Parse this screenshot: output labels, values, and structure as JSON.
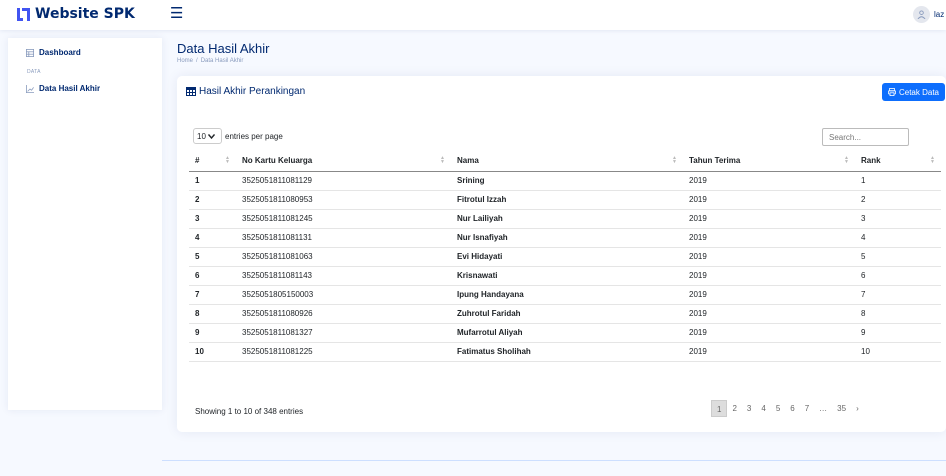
{
  "header": {
    "brand": "Website SPK",
    "user_name": "laz"
  },
  "sidebar": {
    "dashboard_label": "Dashboard",
    "section_heading": "DATA",
    "data_label": "Data Hasil Akhir"
  },
  "page": {
    "title": "Data Hasil Akhir",
    "breadcrumb_home": "Home",
    "breadcrumb_sep": "/",
    "breadcrumb_current": "Data Hasil Akhir"
  },
  "card": {
    "title": "Hasil Akhir Perankingan",
    "print_label": "Cetak Data"
  },
  "datatable": {
    "page_size": "10",
    "entries_label": "entries per page",
    "search_placeholder": "Search...",
    "info": "Showing 1 to 10 of 348 entries",
    "columns": [
      "#",
      "No Kartu Keluarga",
      "Nama",
      "Tahun Terima",
      "Rank"
    ],
    "rows": [
      [
        "1",
        "3525051811081129",
        "Srining",
        "2019",
        "1"
      ],
      [
        "2",
        "3525051811080953",
        "Fitrotul Izzah",
        "2019",
        "2"
      ],
      [
        "3",
        "3525051811081245",
        "Nur Lailiyah",
        "2019",
        "3"
      ],
      [
        "4",
        "3525051811081131",
        "Nur Isnafiyah",
        "2019",
        "4"
      ],
      [
        "5",
        "3525051811081063",
        "Evi Hidayati",
        "2019",
        "5"
      ],
      [
        "6",
        "3525051811081143",
        "Krisnawati",
        "2019",
        "6"
      ],
      [
        "7",
        "3525051805150003",
        "Ipung Handayana",
        "2019",
        "7"
      ],
      [
        "8",
        "3525051811080926",
        "Zuhrotul Faridah",
        "2019",
        "8"
      ],
      [
        "9",
        "3525051811081327",
        "Mufarrotul Aliyah",
        "2019",
        "9"
      ],
      [
        "10",
        "3525051811081225",
        "Fatimatus Sholihah",
        "2019",
        "10"
      ]
    ],
    "pagination": [
      "1",
      "2",
      "3",
      "4",
      "5",
      "6",
      "7",
      "…",
      "35",
      "›"
    ]
  },
  "colors": {
    "brand": "#012970",
    "primary": "#0d6efd",
    "accent": "#4154f1"
  }
}
